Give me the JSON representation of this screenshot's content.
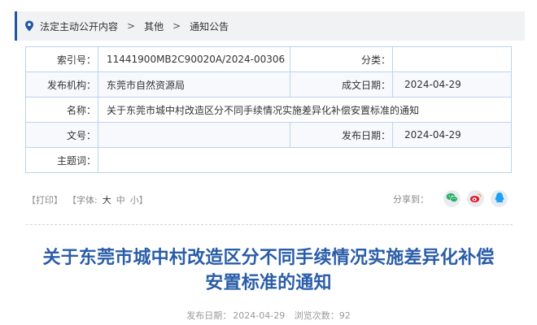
{
  "breadcrumb": {
    "items": [
      "法定主动公开内容",
      "其他",
      "通知公告"
    ],
    "separator": ">"
  },
  "info": {
    "index_label": "索引号：",
    "index_value": "11441900MB2C90020A/2024-00306",
    "category_label": "分类：",
    "category_value": "",
    "publisher_label": "发布机构：",
    "publisher_value": "东莞市自然资源局",
    "written_date_label": "成文日期：",
    "written_date_value": "2024-04-29",
    "name_label": "名称：",
    "name_value": "关于东莞市城中村改造区分不同手续情况实施差异化补偿安置标准的通知",
    "doc_no_label": "文号：",
    "doc_no_value": "",
    "publish_date_label": "发布日期：",
    "publish_date_value": "2024-04-29",
    "subject_label": "主题词：",
    "subject_value": ""
  },
  "tools": {
    "print": "打印",
    "font_label": "字体:",
    "font_large": "大",
    "font_medium": "中",
    "font_small": "小",
    "share_label": "分享到："
  },
  "icons": {
    "location": "location-pin-icon",
    "wechat": "wechat-icon",
    "weibo": "weibo-icon",
    "qq": "qq-icon"
  },
  "colors": {
    "accent": "#2156a5",
    "title": "#2a5da8",
    "table_border": "#bdd3ef",
    "wechat": "#2aae67",
    "weibo": "#e6162d",
    "qq": "#1da1f2"
  },
  "article": {
    "title": "关于东莞市城中村改造区分不同手续情况实施差异化补偿安置标准的通知",
    "title_line1": "关于东莞市城中村改造区分不同手续情况实施差异化补偿",
    "title_line2": "安置标准的通知",
    "publish_date_label": "发布日期：",
    "publish_date": "2024-04-29",
    "views_label": "浏览次数：",
    "views": "92"
  }
}
